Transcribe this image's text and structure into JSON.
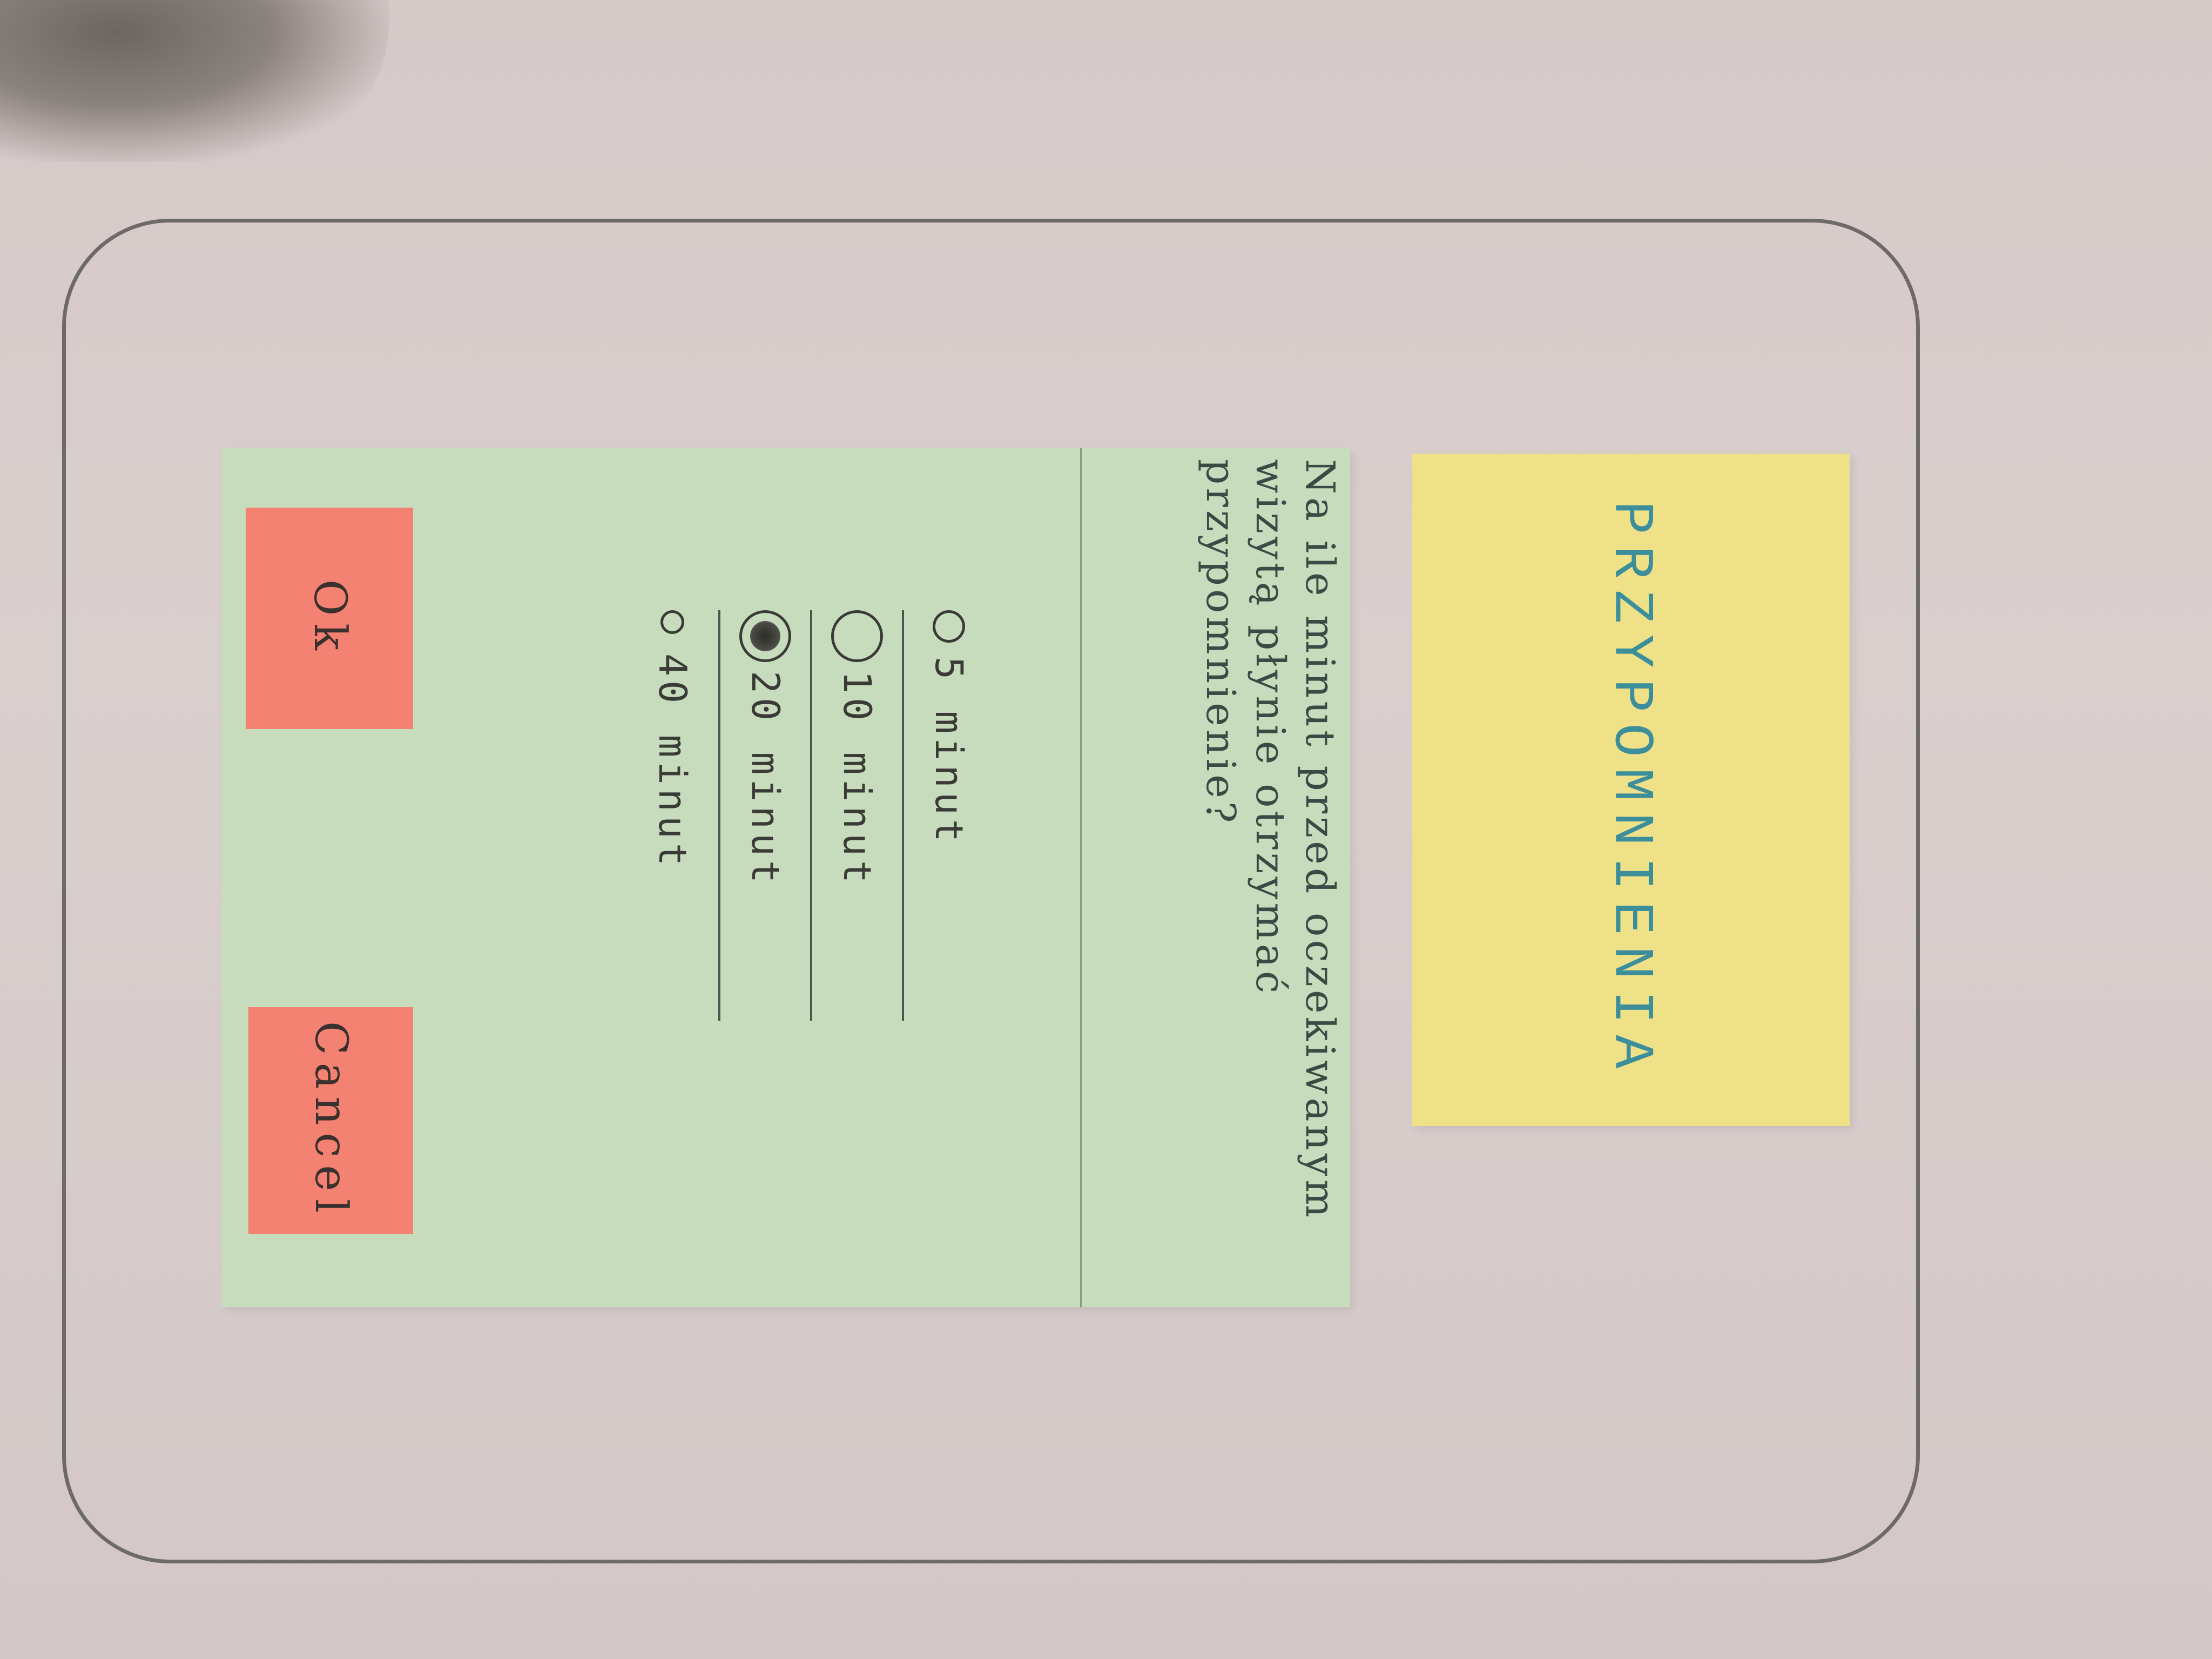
{
  "header": {
    "title": "PRZYPOMNIENIA"
  },
  "dialog": {
    "question": "Na ile minut przed oczekiwanym wizytą płynie otrzymać przypomnienie?",
    "options": [
      {
        "label": "5 minut",
        "selected": false
      },
      {
        "label": "10 minut",
        "selected": false
      },
      {
        "label": "20 minut",
        "selected": true
      },
      {
        "label": "40 minut",
        "selected": false
      }
    ],
    "ok_label": "Ok",
    "cancel_label": "Cancel"
  },
  "colors": {
    "title_note": "#eee188",
    "dialog_note": "#c7dcbd",
    "button": "#f38273",
    "title_text": "#3c8f9a"
  }
}
